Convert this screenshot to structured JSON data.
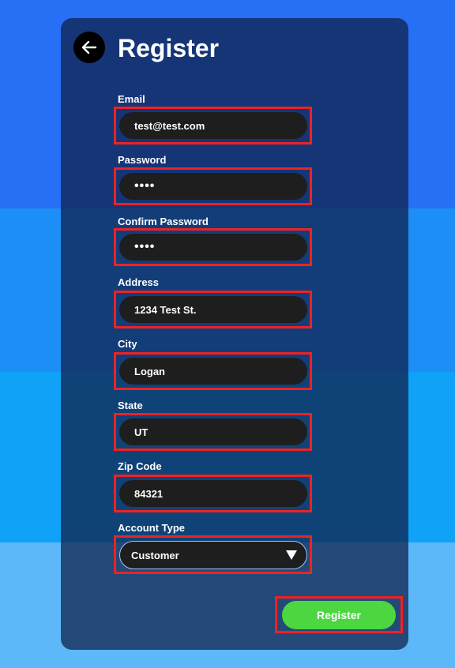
{
  "header": {
    "title": "Register",
    "back_icon": "arrow-left-icon"
  },
  "form": {
    "email": {
      "label": "Email",
      "value": "test@test.com"
    },
    "password": {
      "label": "Password",
      "value": "••••"
    },
    "confirm_password": {
      "label": "Confirm Password",
      "value": "••••"
    },
    "address": {
      "label": "Address",
      "value": "1234 Test St."
    },
    "city": {
      "label": "City",
      "value": "Logan"
    },
    "state": {
      "label": "State",
      "value": "UT"
    },
    "zip": {
      "label": "Zip Code",
      "value": "84321"
    },
    "account_type": {
      "label": "Account Type",
      "selected": "Customer"
    }
  },
  "submit_label": "Register",
  "colors": {
    "accent": "#4cd63f",
    "highlight": "#ee2222",
    "card": "#0f1e46",
    "field": "#1e1e1e"
  }
}
